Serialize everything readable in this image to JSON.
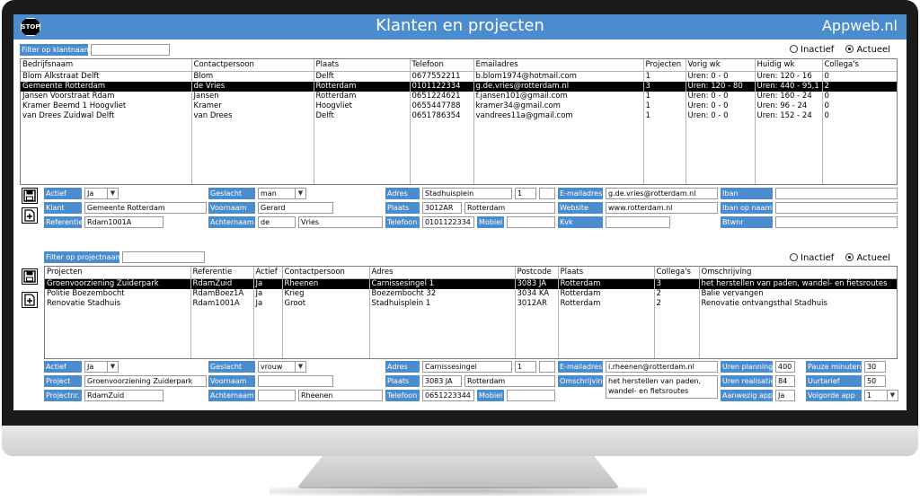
{
  "app": {
    "title": "Klanten en projecten",
    "brand": "Appweb.nl",
    "stop_label": "STOP"
  },
  "radio": {
    "inactive": "Inactief",
    "active": "Actueel"
  },
  "clients": {
    "filter_label": "Filter op klantnaam",
    "filter_value": "",
    "columns": [
      "Bedrijfsnaam",
      "Contactpersoon",
      "Plaats",
      "Telefoon",
      "Emailadres",
      "Projecten",
      "Vorig wk",
      "Huidig wk",
      "Collega's"
    ],
    "rows": [
      [
        "Blom Alkstraat Delft",
        "Blom",
        "Delft",
        "0677552211",
        "b.blom1974@hotmail.com",
        "1",
        "Uren: 0 - 0",
        "Uren: 120 - 16",
        "0"
      ],
      [
        "Gemeente Rotterdam",
        "de Vries",
        "Rotterdam",
        "0101122334",
        "g.de.vries@rotterdam.nl",
        "3",
        "Uren: 120 - 80",
        "Uren: 440 - 95,1",
        "2"
      ],
      [
        "Jansen Voorstraat Rdam",
        "Jansen",
        "Rotterdam",
        "0651224621",
        "f.jansen101@gmail.com",
        "1",
        "Uren: 0 - 0",
        "Uren: 160 - 24",
        "0"
      ],
      [
        "Kramer Beemd 1 Hoogvliet",
        "Kramer",
        "Hoogvliet",
        "0655447788",
        "kramer34@gmail.com",
        "1",
        "Uren: 0 - 0",
        "Uren: 96 - 24",
        "0"
      ],
      [
        "van Drees Zuidwal Delft",
        "van Drees",
        "Delft",
        "0651786354",
        "vandrees11a@gmail.com",
        "1",
        "Uren: 0 - 0",
        "Uren: 152 - 24",
        "0"
      ]
    ],
    "form": {
      "actief_label": "Actief",
      "actief_value": "Ja",
      "klant_label": "Klant",
      "klant_value": "Gemeente Rotterdam",
      "referentie_label": "Referentie",
      "referentie_value": "Rdam1001A",
      "geslacht_label": "Geslacht",
      "geslacht_value": "man",
      "voornaam_label": "Voornaam",
      "voornaam_value": "Gerard",
      "achternaam_label": "Achternaam",
      "tussenvoegsel_value": "de",
      "achternaam_value": "Vries",
      "adres_label": "Adres",
      "adres_value": "Stadhuisplein",
      "huisnr_value": "1",
      "toevoeging_value": "",
      "plaats_label": "Plaats",
      "postcode_value": "3012AR",
      "plaats_value": "Rotterdam",
      "telefoon_label": "Telefoon",
      "telefoon_value": "0101122334",
      "mobiel_label": "Mobiel",
      "mobiel_value": "",
      "email_label": "E-mailadres",
      "email_value": "g.de.vries@rotterdam.nl",
      "website_label": "Website",
      "website_value": "www.rotterdam.nl",
      "kvk_label": "Kvk",
      "kvk_value": "",
      "iban_label": "Iban",
      "iban_value": "",
      "iban_naam_label": "Iban op naam",
      "iban_naam_value": "",
      "btwnr_label": "Btwnr",
      "btwnr_value": ""
    }
  },
  "projects": {
    "filter_label": "Filter op projectnaam",
    "filter_value": "",
    "columns": [
      "Projecten",
      "Referentie",
      "Actief",
      "Contactpersoon",
      "Adres",
      "Postcode",
      "Plaats",
      "Collega's",
      "Omschrijving"
    ],
    "rows": [
      [
        "Groenvoorziening Zuiderpark",
        "RdamZuid",
        "Ja",
        "Rheenen",
        "Carnissesingel 1",
        "3083 JA",
        "Rotterdam",
        "3",
        "het herstellen van paden, wandel- en fietsroutes"
      ],
      [
        "Politie Boezembocht",
        "RdamBoez1A",
        "Ja",
        "Krieg",
        "Boezembocht 32",
        "3034 KA",
        "Rotterdam",
        "2",
        "Balie vervangen"
      ],
      [
        "Renovatie Stadhuis",
        "Rdam1001A",
        "Ja",
        "Groot",
        "Stadhuisplein 1",
        "3012AR",
        "Rotterdam",
        "2",
        "Renovatie ontvangsthal Stadhuis"
      ]
    ],
    "form": {
      "actief_label": "Actief",
      "actief_value": "Ja",
      "project_label": "Project",
      "project_value": "Groenvoorziening Zuiderpark",
      "projectnr_label": "Projectnr.",
      "projectnr_value": "RdamZuid",
      "geslacht_label": "Geslacht",
      "geslacht_value": "vrouw",
      "voornaam_label": "Voornaam",
      "voornaam_value": "",
      "achternaam_label": "Achternaam",
      "tussenvoegsel_value": "",
      "achternaam_value": "Rheenen",
      "adres_label": "Adres",
      "adres_value": "Carnissesingel",
      "huisnr_value": "1",
      "toevoeging_value": "",
      "plaats_label": "Plaats",
      "postcode_value": "3083 JA",
      "plaats_value": "Rotterdam",
      "telefoon_label": "Telefoon",
      "telefoon_value": "0651223344",
      "mobiel_label": "Mobiel",
      "mobiel_value": "",
      "email_label": "E-mailadres",
      "email_value": "i.rheenen@rotterdam.nl",
      "omschrijving_label": "Omschrijving",
      "omschrijving_value": "het herstellen van paden, wandel- en fietsroutes",
      "uren_planning_label": "Uren planning",
      "uren_planning_value": "400",
      "uren_realisatie_label": "Uren realisatie",
      "uren_realisatie_value": "84",
      "aanwezig_app_label": "Aanwezig app",
      "aanwezig_app_value": "Ja",
      "pauze_label": "Pauze minuten",
      "pauze_value": "30",
      "uurtarief_label": "Uurtarief",
      "uurtarief_value": "50",
      "volgorde_label": "Volgorde app",
      "volgorde_value": "1"
    }
  },
  "icons": {
    "save": "floppy-disk-icon",
    "add": "add-document-icon",
    "stop": "stop-sign-icon",
    "dropdown": "chevron-down-icon"
  },
  "colors": {
    "accent": "#4a8ccd",
    "selection": "#000000"
  }
}
